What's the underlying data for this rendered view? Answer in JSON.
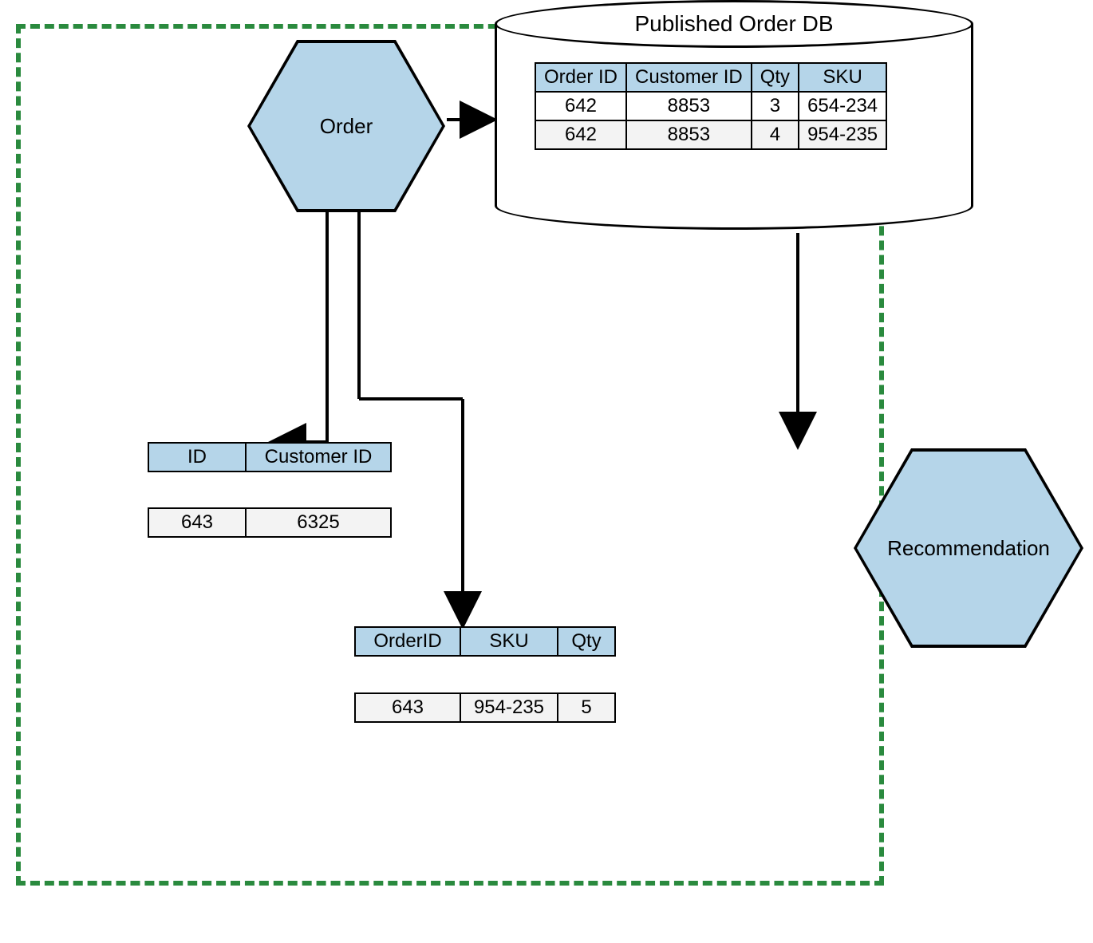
{
  "services": {
    "order": "Order",
    "recommendation": "Recommendation"
  },
  "database": {
    "title": "Published Order DB",
    "columns": [
      "Order ID",
      "Customer ID",
      "Qty",
      "SKU"
    ],
    "rows": [
      {
        "order_id": "642",
        "customer_id": "8853",
        "qty": "3",
        "sku": "654-234"
      },
      {
        "order_id": "642",
        "customer_id": "8853",
        "qty": "4",
        "sku": "954-235"
      }
    ]
  },
  "order_table": {
    "columns": [
      "ID",
      "Customer ID"
    ],
    "row": {
      "id": "643",
      "customer_id": "6325"
    }
  },
  "line_item_table": {
    "columns": [
      "OrderID",
      "SKU",
      "Qty"
    ],
    "row": {
      "order_id": "643",
      "sku": "954-235",
      "qty": "5"
    }
  }
}
